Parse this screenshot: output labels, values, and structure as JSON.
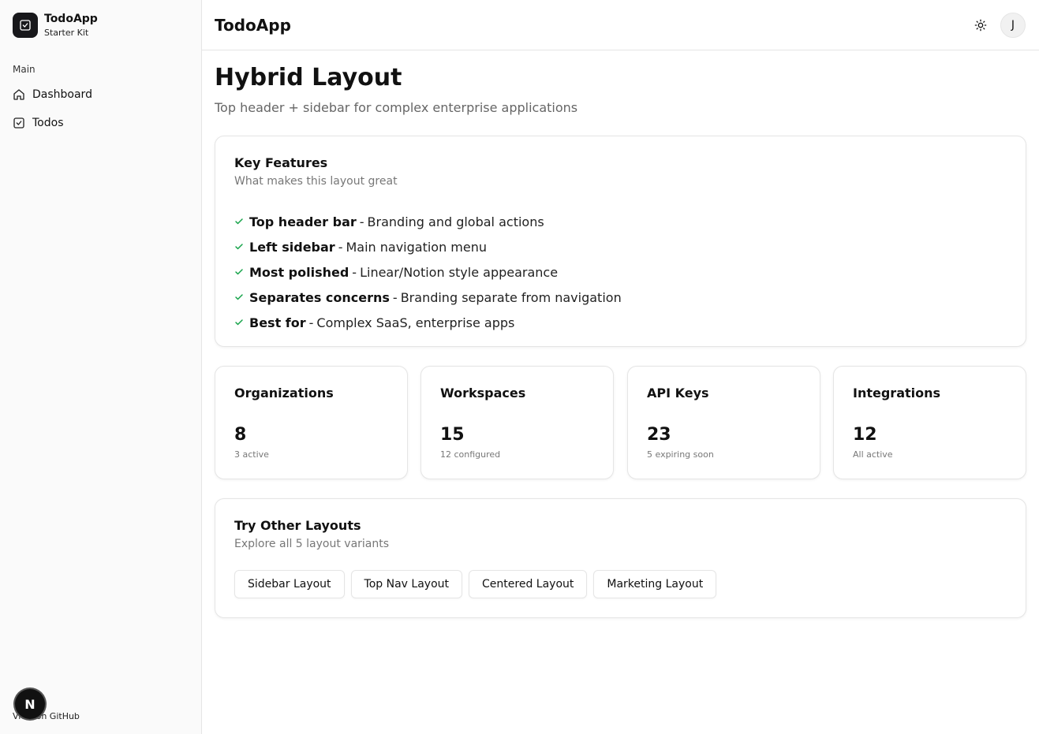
{
  "app": {
    "name": "TodoApp",
    "subtitle": "Starter Kit"
  },
  "sidebar": {
    "section_label": "Main",
    "items": [
      {
        "label": "Dashboard",
        "icon": "home-icon"
      },
      {
        "label": "Todos",
        "icon": "check-square-icon"
      }
    ],
    "github_label": "View on GitHub",
    "badge_letter": "N"
  },
  "header": {
    "title": "TodoApp",
    "avatar_initial": "J",
    "theme_icon": "sun-icon"
  },
  "page": {
    "title": "Hybrid Layout",
    "subtitle": "Top header + sidebar for complex enterprise applications"
  },
  "features": {
    "title": "Key Features",
    "description": "What makes this layout great",
    "items": [
      {
        "name": "Top header bar",
        "separator": "-",
        "text": "Branding and global actions"
      },
      {
        "name": "Left sidebar",
        "separator": "-",
        "text": "Main navigation menu"
      },
      {
        "name": "Most polished",
        "separator": "-",
        "text": "Linear/Notion style appearance"
      },
      {
        "name": "Separates concerns",
        "separator": "-",
        "text": "Branding separate from navigation"
      },
      {
        "name": "Best for",
        "separator": "-",
        "text": "Complex SaaS, enterprise apps"
      }
    ]
  },
  "stats": [
    {
      "label": "Organizations",
      "value": "8",
      "sub": "3 active"
    },
    {
      "label": "Workspaces",
      "value": "15",
      "sub": "12 configured"
    },
    {
      "label": "API Keys",
      "value": "23",
      "sub": "5 expiring soon"
    },
    {
      "label": "Integrations",
      "value": "12",
      "sub": "All active"
    }
  ],
  "layouts": {
    "title": "Try Other Layouts",
    "description": "Explore all 5 layout variants",
    "buttons": [
      "Sidebar Layout",
      "Top Nav Layout",
      "Centered Layout",
      "Marketing Layout"
    ]
  },
  "colors": {
    "check": "#16a34a",
    "brand_dark": "#18181b"
  }
}
